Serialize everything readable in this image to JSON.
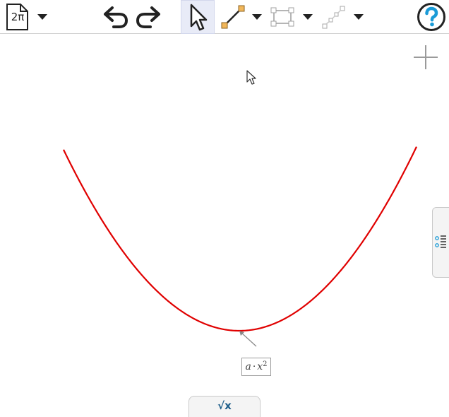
{
  "toolbar": {
    "document_label": "2π",
    "icons": [
      "document-icon",
      "undo-icon",
      "redo-icon",
      "move-icon",
      "segment-icon",
      "polygon-icon",
      "points-icon",
      "help-icon"
    ]
  },
  "graph": {
    "curve_color": "#e00000",
    "function": {
      "a": 1,
      "exponent": 2
    }
  },
  "label": {
    "a": "a",
    "dot": "·",
    "x": "x",
    "exp": "2"
  },
  "bottom_tab": {
    "label": "√x"
  }
}
